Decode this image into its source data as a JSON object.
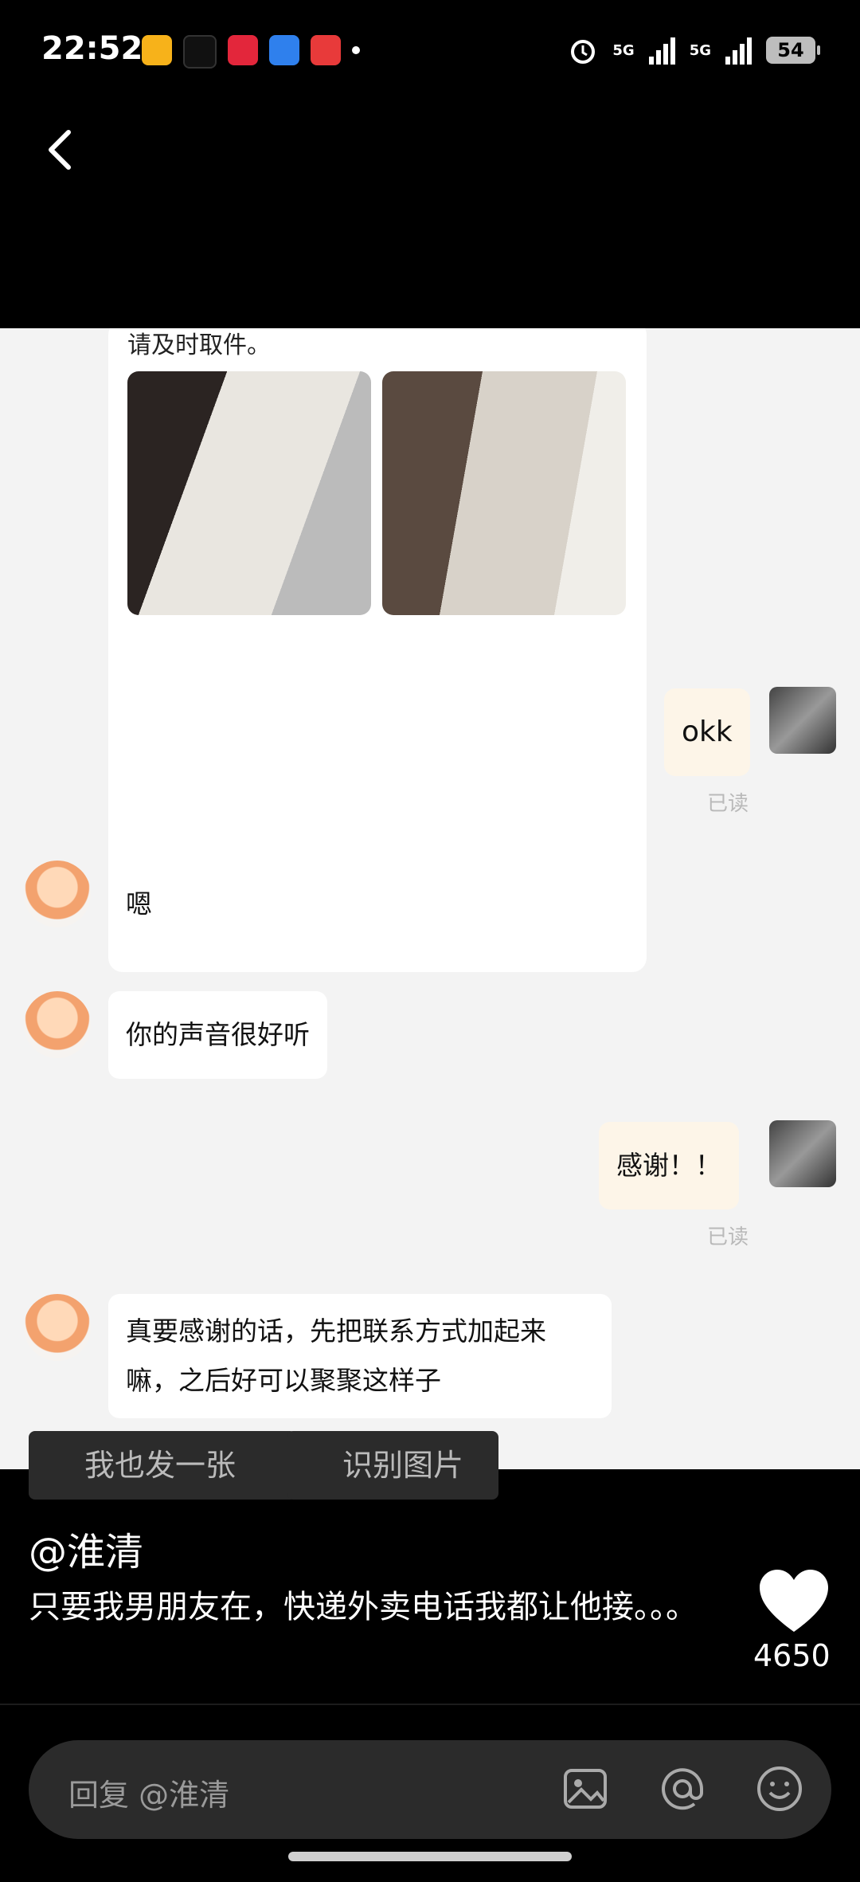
{
  "status_bar": {
    "time": "22:52",
    "network1": "5G",
    "network2": "5G",
    "battery": "54"
  },
  "screenshot": {
    "cut_text": "请及时取件。",
    "messages": [
      {
        "side": "right",
        "text": "okk",
        "status": "已读"
      },
      {
        "side": "left",
        "text": "嗯"
      },
      {
        "side": "left",
        "text": "你的声音很好听"
      },
      {
        "side": "right",
        "text": "感谢！！",
        "status": "已读"
      },
      {
        "side": "left",
        "text": "真要感谢的话，先把联系方式加起来嘛，之后好可以聚聚这样子"
      }
    ]
  },
  "actions": {
    "post_too": "我也发一张",
    "recognize": "识别图片"
  },
  "post": {
    "author": "@淮清",
    "caption": "只要我男朋友在，快递外卖电话我都让他接。。。",
    "likes": "4650"
  },
  "reply": {
    "placeholder": "回复 @淮清"
  }
}
